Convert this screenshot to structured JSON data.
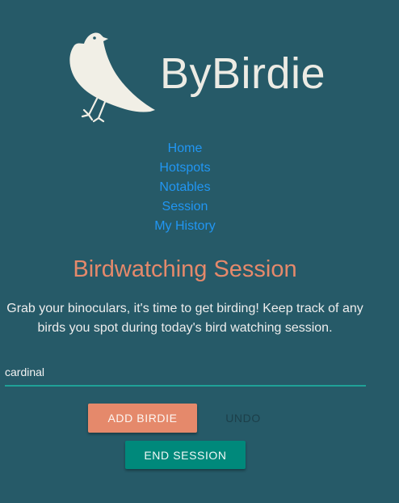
{
  "header": {
    "brand": "ByBirdie",
    "logo_icon": "bird-icon"
  },
  "nav": {
    "items": [
      {
        "label": "Home"
      },
      {
        "label": "Hotspots"
      },
      {
        "label": "Notables"
      },
      {
        "label": "Session"
      },
      {
        "label": "My History"
      }
    ]
  },
  "session": {
    "title": "Birdwatching Session",
    "description_line1": "Grab your binoculars, it's time to get birding! Keep track of any",
    "description_line2": "birds you spot during today's bird watching session.",
    "input_value": "cardinal",
    "add_label": "Add Birdie",
    "undo_label": "Undo",
    "end_label": "End Session"
  },
  "colors": {
    "background": "#265a68",
    "accent": "#e5896b",
    "link": "#2196f3",
    "teal": "#00897b"
  }
}
